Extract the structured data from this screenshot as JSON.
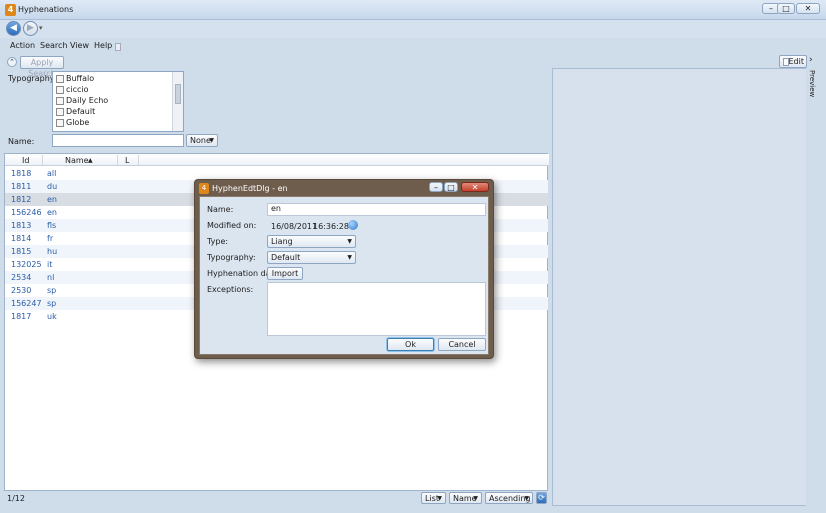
{
  "window": {
    "title": "Hyphenations",
    "app_glyph": "4",
    "min": "–",
    "max": "□",
    "close": "✕"
  },
  "nav": {
    "back": "◀",
    "forward": "▶",
    "dropdown": "▾"
  },
  "menu": [
    "Action",
    "Search",
    "View",
    "Help"
  ],
  "search": {
    "apply_label": "Apply Search",
    "typography_label": "Typography:",
    "typographies": [
      "Buffalo",
      "ciccio",
      "Daily Echo",
      "Default",
      "Globe"
    ],
    "name_label": "Name:",
    "name_value": "",
    "match_mode": "None"
  },
  "grid": {
    "columns": [
      "Id",
      "Name",
      "L"
    ],
    "sort_arrow": "▲",
    "rows": [
      {
        "id": "1818",
        "name": "all"
      },
      {
        "id": "1811",
        "name": "du"
      },
      {
        "id": "1812",
        "name": "en"
      },
      {
        "id": "156246",
        "name": "en"
      },
      {
        "id": "1813",
        "name": "fls"
      },
      {
        "id": "1814",
        "name": "fr"
      },
      {
        "id": "1815",
        "name": "hu"
      },
      {
        "id": "132025",
        "name": "it"
      },
      {
        "id": "2534",
        "name": "nl"
      },
      {
        "id": "2530",
        "name": "sp"
      },
      {
        "id": "156247",
        "name": "sp"
      },
      {
        "id": "1817",
        "name": "uk"
      }
    ]
  },
  "status": {
    "count": "1/12",
    "view": "List",
    "sort_field": "Name",
    "sort_order": "Ascending",
    "refresh_glyph": "⟳"
  },
  "right": {
    "edit_label": "Edit",
    "preview_label": "Preview",
    "collapse": "›"
  },
  "dialog": {
    "title": "HyphenEdtDlg - en",
    "name_label": "Name:",
    "name_value": "en",
    "modified_label": "Modified on:",
    "modified_date": "16/08/2011",
    "modified_time": "16:36:28",
    "type_label": "Type:",
    "type_value": "Liang",
    "typography_label": "Typography:",
    "typography_value": "Default",
    "hyph_label": "Hyphenation data:",
    "import_label": "Import",
    "exceptions_label": "Exceptions:",
    "ok_label": "Ok",
    "cancel_label": "Cancel"
  }
}
